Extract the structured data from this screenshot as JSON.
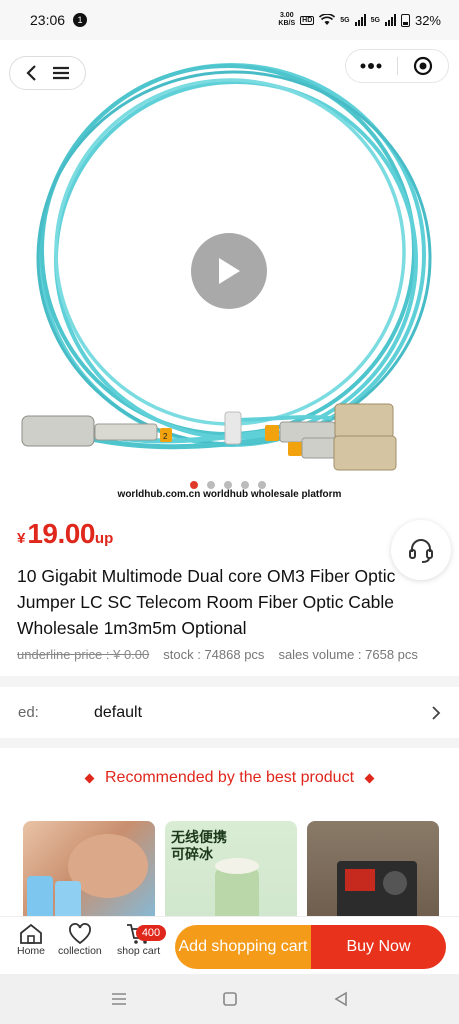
{
  "status_bar": {
    "time": "23:06",
    "notification_count": "1",
    "net_speed_value": "3.00",
    "net_speed_unit": "KB/S",
    "hd_label": "HD",
    "sim1_label": "5G",
    "sim2_label": "5G",
    "battery_percent": "32%"
  },
  "hero": {
    "watermark": "worldhub.com.cn worldhub wholesale platform",
    "carousel_count": 5,
    "carousel_active_index": 0,
    "cable_color": "#5fd0d8"
  },
  "product": {
    "currency": "¥",
    "price": "19.00",
    "price_suffix": "up",
    "title": "10 Gigabit Multimode Dual core OM3 Fiber Optic Jumper LC SC Telecom Room Fiber Optic Cable Wholesale 1m3m5m Optional",
    "underline_price": "underline price : ¥ 0.00",
    "stock": "stock : 74868 pcs",
    "sales_volume": "sales volume : 7658 pcs"
  },
  "spec": {
    "label": "ed:",
    "value": "default"
  },
  "recommend": {
    "title": "Recommended by the best product",
    "card2_text_line1": "无线便携",
    "card2_text_line2": "可碎冰"
  },
  "action_bar": {
    "home_label": "Home",
    "collection_label": "collection",
    "cart_label": "shop cart",
    "cart_badge": "400",
    "add_cart_label": "Add shopping cart",
    "buy_label": "Buy Now"
  },
  "colors": {
    "accent_red": "#e0271c",
    "orange": "#f59b1a",
    "buy_red": "#e8321c"
  }
}
